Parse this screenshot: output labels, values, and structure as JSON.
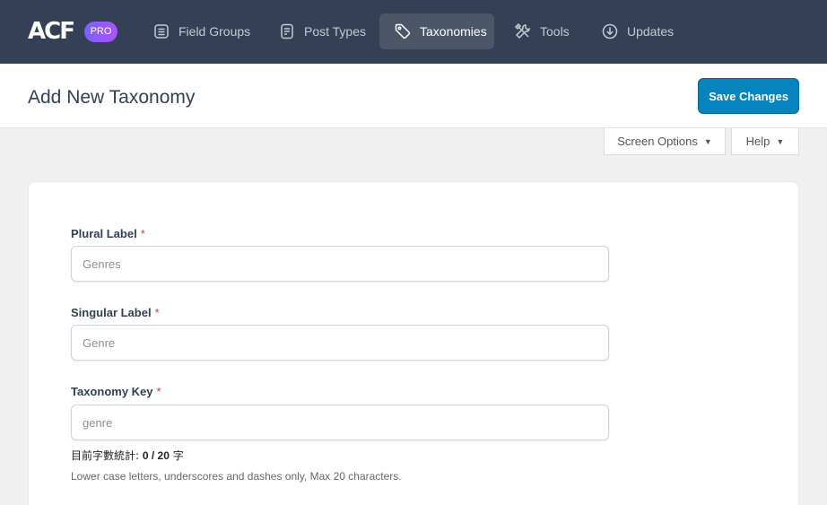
{
  "brand": {
    "logo_text": "ACF",
    "badge": "PRO"
  },
  "nav": {
    "field_groups": "Field Groups",
    "post_types": "Post Types",
    "taxonomies": "Taxonomies",
    "tools": "Tools",
    "updates": "Updates",
    "active": "taxonomies"
  },
  "header": {
    "title": "Add New Taxonomy",
    "save_label": "Save Changes"
  },
  "screen_meta": {
    "screen_options": "Screen Options",
    "help": "Help"
  },
  "form": {
    "plural": {
      "label": "Plural Label",
      "required_mark": "*",
      "placeholder": "Genres",
      "value": ""
    },
    "singular": {
      "label": "Singular Label",
      "required_mark": "*",
      "placeholder": "Genre",
      "value": ""
    },
    "key": {
      "label": "Taxonomy Key",
      "required_mark": "*",
      "placeholder": "genre",
      "value": "",
      "count_prefix": "目前字數統計:",
      "count_value": "0 / 20",
      "count_suffix": "字",
      "hint": "Lower case letters, underscores and dashes only, Max 20 characters."
    }
  },
  "colors": {
    "topbar": "#344055",
    "accent": "#0783be",
    "required": "#d63638",
    "badge_start": "#7b61ff",
    "badge_end": "#a855f7"
  }
}
